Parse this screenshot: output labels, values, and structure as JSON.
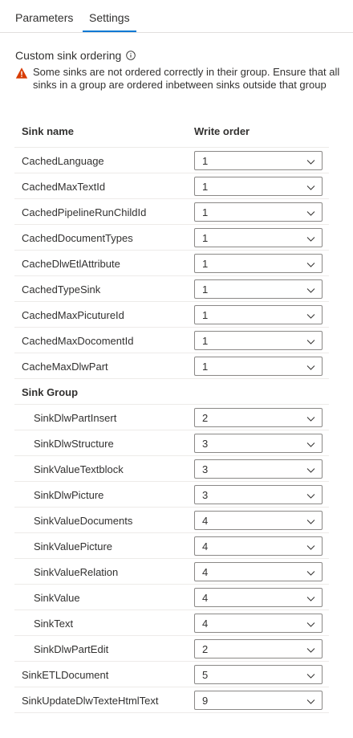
{
  "tabs": [
    {
      "label": "Parameters",
      "active": false
    },
    {
      "label": "Settings",
      "active": true
    }
  ],
  "section": {
    "title": "Custom sink ordering",
    "info_icon": "info-icon"
  },
  "warning": {
    "icon": "warning-icon",
    "text": "Some sinks are not ordered correctly in their group. Ensure that all sinks in a group are ordered inbetween sinks outside that group",
    "color": "#d83b01"
  },
  "table": {
    "headers": {
      "name": "Sink name",
      "order": "Write order"
    },
    "rows": [
      {
        "name": "CachedLanguage",
        "order": "1",
        "kind": "top"
      },
      {
        "name": "CachedMaxTextId",
        "order": "1",
        "kind": "top"
      },
      {
        "name": "CachedPipelineRunChildId",
        "order": "1",
        "kind": "top"
      },
      {
        "name": "CachedDocumentTypes",
        "order": "1",
        "kind": "top"
      },
      {
        "name": "CacheDlwEtlAttribute",
        "order": "1",
        "kind": "top"
      },
      {
        "name": "CachedTypeSink",
        "order": "1",
        "kind": "top"
      },
      {
        "name": "CachedMaxPicutureId",
        "order": "1",
        "kind": "top"
      },
      {
        "name": "CachedMaxDocomentId",
        "order": "1",
        "kind": "top"
      },
      {
        "name": "CacheMaxDlwPart",
        "order": "1",
        "kind": "top"
      },
      {
        "name": "Sink Group",
        "order": null,
        "kind": "group"
      },
      {
        "name": "SinkDlwPartInsert",
        "order": "2",
        "kind": "child"
      },
      {
        "name": "SinkDlwStructure",
        "order": "3",
        "kind": "child"
      },
      {
        "name": "SinkValueTextblock",
        "order": "3",
        "kind": "child"
      },
      {
        "name": "SinkDlwPicture",
        "order": "3",
        "kind": "child"
      },
      {
        "name": "SinkValueDocuments",
        "order": "4",
        "kind": "child"
      },
      {
        "name": "SinkValuePicture",
        "order": "4",
        "kind": "child"
      },
      {
        "name": "SinkValueRelation",
        "order": "4",
        "kind": "child"
      },
      {
        "name": "SinkValue",
        "order": "4",
        "kind": "child"
      },
      {
        "name": "SinkText",
        "order": "4",
        "kind": "child"
      },
      {
        "name": "SinkDlwPartEdit",
        "order": "2",
        "kind": "child"
      },
      {
        "name": "SinkETLDocument",
        "order": "5",
        "kind": "top"
      },
      {
        "name": "SinkUpdateDlwTexteHtmlText",
        "order": "9",
        "kind": "top"
      }
    ]
  },
  "colors": {
    "accent": "#0078d4",
    "border": "#8a8886",
    "divider": "#edebe9",
    "text": "#323130"
  }
}
